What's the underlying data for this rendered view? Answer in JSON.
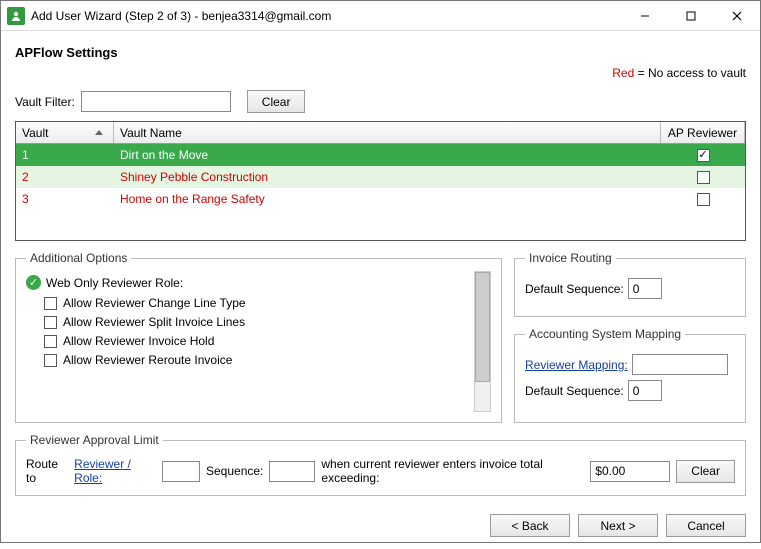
{
  "window": {
    "title": "Add User Wizard (Step 2 of 3) - benjea3314@gmail.com"
  },
  "heading": "APFlow Settings",
  "legend": {
    "red_label": "Red",
    "red_meaning": " = No access to vault"
  },
  "filter": {
    "label": "Vault Filter:",
    "value": "",
    "clear": "Clear"
  },
  "grid": {
    "headers": {
      "vault": "Vault",
      "name": "Vault Name",
      "reviewer": "AP Reviewer"
    },
    "rows": [
      {
        "vault": "1",
        "name": "Dirt on the Move",
        "reviewer_checked": true,
        "selected": true,
        "no_access": false
      },
      {
        "vault": "2",
        "name": "Shiney Pebble Construction",
        "reviewer_checked": false,
        "selected": false,
        "no_access": true,
        "alt": true
      },
      {
        "vault": "3",
        "name": "Home on the Range Safety",
        "reviewer_checked": false,
        "selected": false,
        "no_access": true
      }
    ]
  },
  "options": {
    "legend": "Additional Options",
    "web_only": "Web Only Reviewer Role:",
    "items": [
      "Allow Reviewer Change Line Type",
      "Allow Reviewer Split Invoice Lines",
      "Allow Reviewer Invoice Hold",
      "Allow Reviewer Reroute Invoice"
    ]
  },
  "routing": {
    "legend": "Invoice Routing",
    "default_seq_label": "Default Sequence:",
    "default_seq": "0"
  },
  "mapping": {
    "legend": "Accounting System Mapping",
    "link": "Reviewer Mapping:",
    "value": "",
    "default_seq_label": "Default Sequence:",
    "default_seq": "0"
  },
  "limit": {
    "legend": "Reviewer Approval Limit",
    "route_to": "Route to",
    "reviewer_link": "Reviewer / Role:",
    "route_value": "",
    "seq_label": "Sequence:",
    "seq_value": "",
    "when_text": "when current reviewer enters invoice total exceeding:",
    "amount": "$0.00",
    "clear": "Clear"
  },
  "footer": {
    "back": "< Back",
    "next": "Next >",
    "cancel": "Cancel"
  }
}
